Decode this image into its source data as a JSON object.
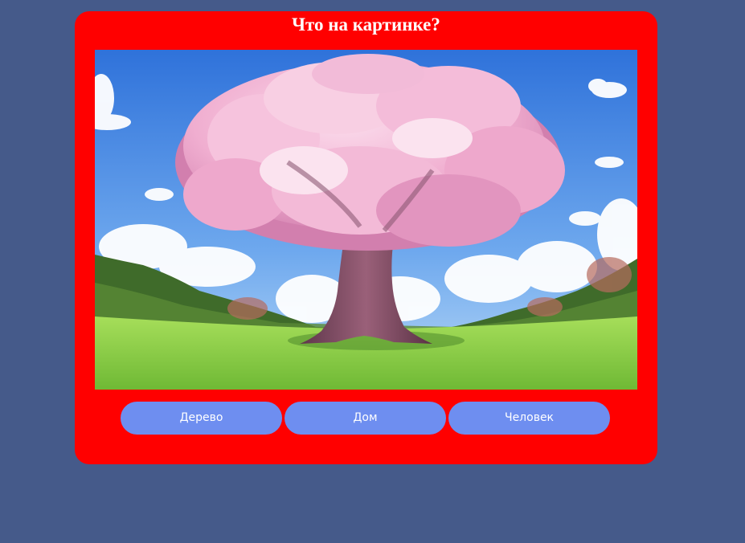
{
  "quiz": {
    "title": "Что на картинке?",
    "image": {
      "subject": "cherry-blossom-tree-landscape",
      "colors": {
        "sky_top": "#3a7fe0",
        "sky_bottom": "#9cc8f5",
        "cloud": "#ffffff",
        "blossom": "#f2b6d2",
        "blossom_shadow": "#d77fab",
        "trunk": "#7a4a5e",
        "grass": "#8fd24a",
        "grass_dark": "#5c9d2e",
        "forest": "#3f6b2a"
      }
    },
    "answers": [
      {
        "label": "Дерево"
      },
      {
        "label": "Дом"
      },
      {
        "label": "Человек"
      }
    ],
    "colors": {
      "page_background": "#455a8a",
      "card_background": "#ff0000",
      "button_background": "#6e8ef0",
      "button_text": "#ffffff",
      "title_text": "#ffffff"
    }
  }
}
